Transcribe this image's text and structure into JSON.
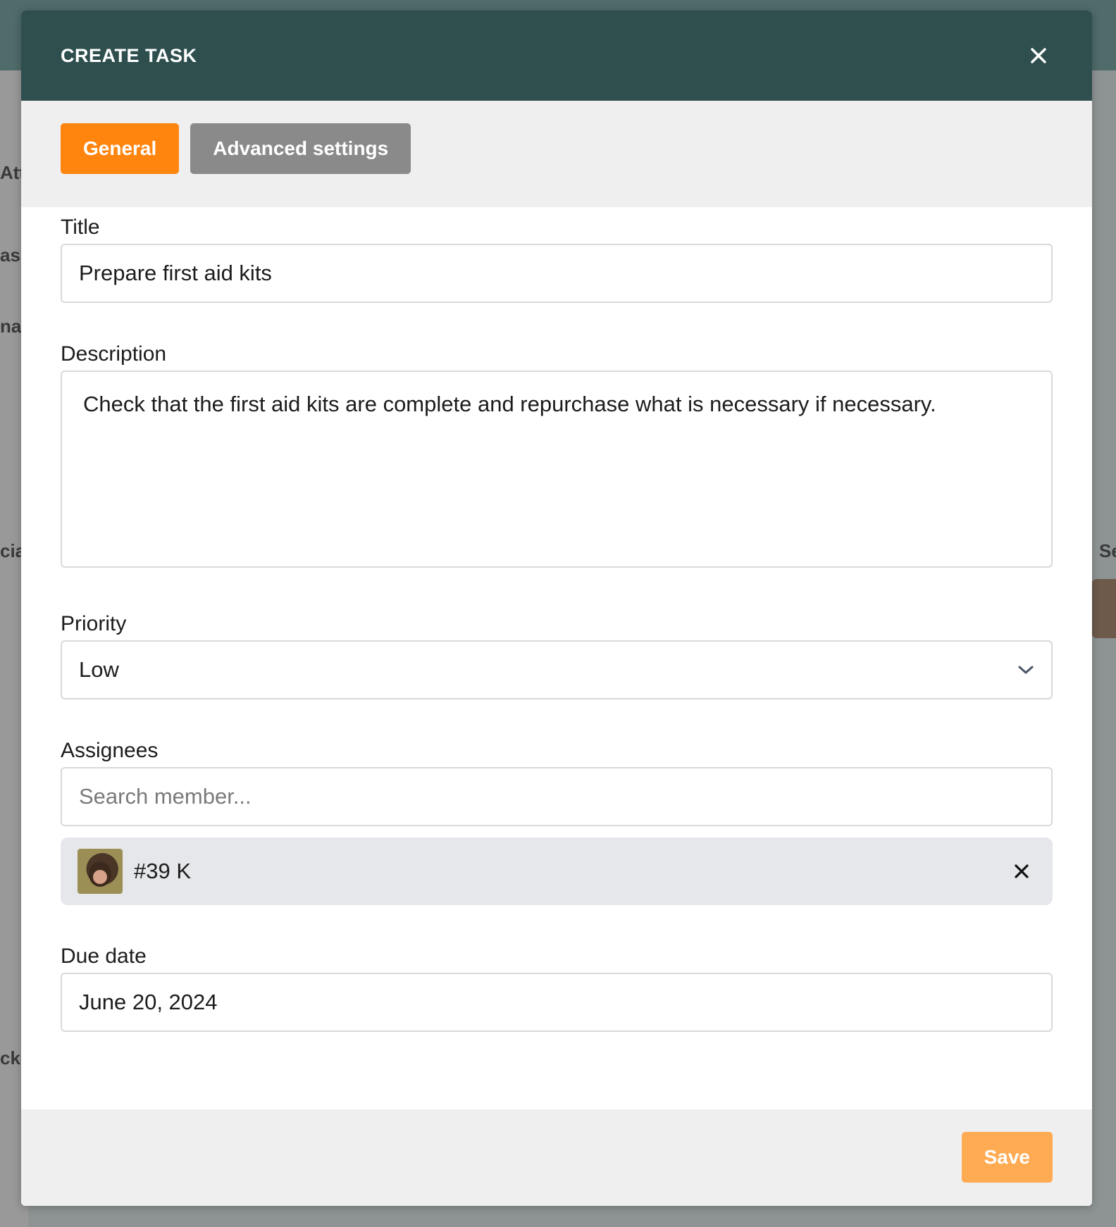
{
  "background": {
    "fragments": [
      "Att",
      "as",
      "nat",
      "cia",
      "cke",
      "Se"
    ]
  },
  "modal": {
    "title": "CREATE TASK",
    "close_icon": "close-icon"
  },
  "tabs": [
    {
      "label": "General",
      "active": true
    },
    {
      "label": "Advanced settings",
      "active": false
    }
  ],
  "form": {
    "title": {
      "label": "Title",
      "value": "Prepare first aid kits"
    },
    "description": {
      "label": "Description",
      "value": "Check that the first aid kits are complete and repurchase what is necessary if necessary."
    },
    "priority": {
      "label": "Priority",
      "value": "Low"
    },
    "assignees": {
      "label": "Assignees",
      "placeholder": "Search member...",
      "selected": [
        {
          "name": "#39 K"
        }
      ]
    },
    "due_date": {
      "label": "Due date",
      "value": "June 20, 2024"
    }
  },
  "footer": {
    "save_label": "Save"
  },
  "colors": {
    "header": "#2f4f4f",
    "accent": "#ff850f",
    "save": "#ffab53",
    "tab_inactive": "#8a8a8a"
  }
}
